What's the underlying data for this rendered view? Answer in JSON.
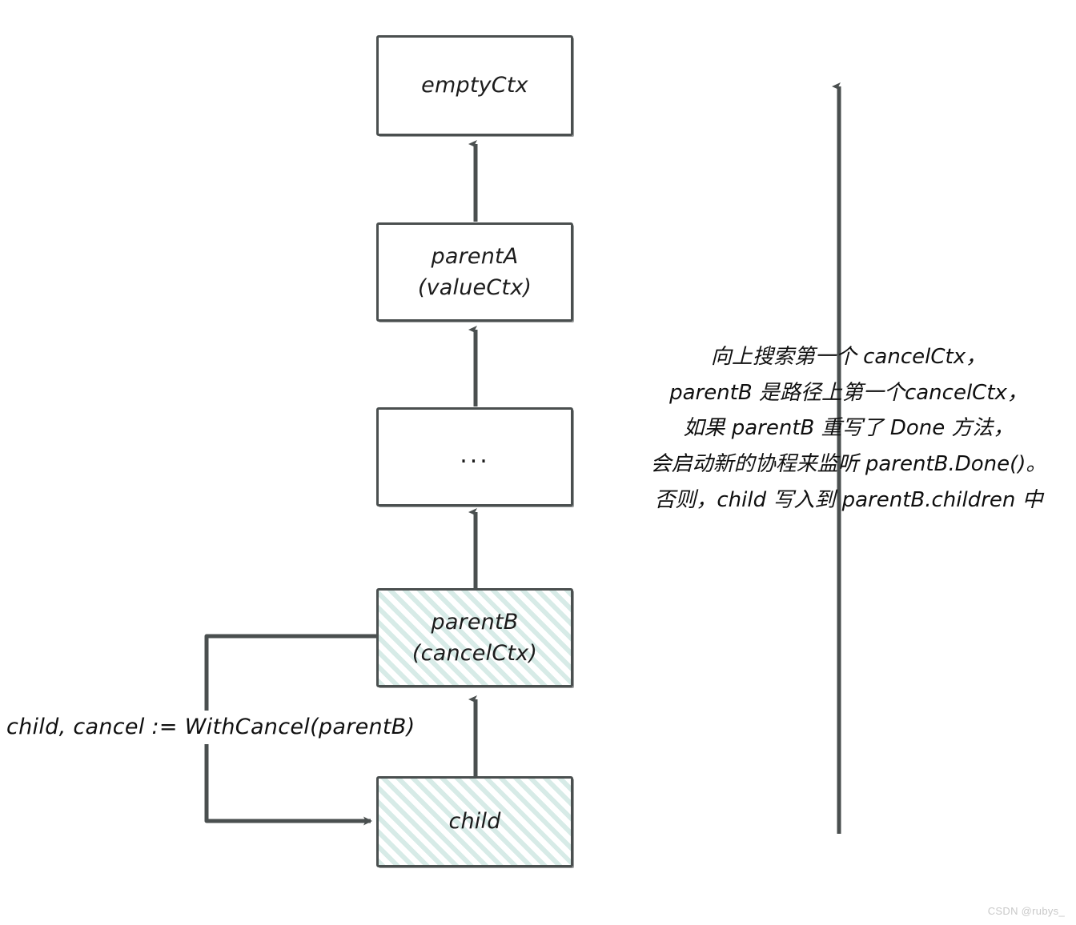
{
  "diagram": {
    "title": "Go context WithCancel parent search",
    "nodes": [
      {
        "id": "emptyCtx",
        "line1": "emptyCtx",
        "line2": "",
        "hatched": false
      },
      {
        "id": "parentA",
        "line1": "parentA",
        "line2": "(valueCtx)",
        "hatched": false
      },
      {
        "id": "ellipsis",
        "line1": "...",
        "line2": "",
        "hatched": false
      },
      {
        "id": "parentB",
        "line1": "parentB",
        "line2": "(cancelCtx)",
        "hatched": true
      },
      {
        "id": "child",
        "line1": "child",
        "line2": "",
        "hatched": true
      }
    ],
    "left_note": "child, cancel := WithCancel(parentB)",
    "right_note_lines": [
      "向上搜索第一个 cancelCtx，",
      "parentB 是路径上第一个cancelCtx，",
      "如果 parentB 重写了 Done 方法，",
      "会启动新的协程来监听 parentB.Done()。",
      "否则，child 写入到 parentB.children 中"
    ],
    "colors": {
      "stroke": "#4a4f4f",
      "hatch": "#d7ebe7",
      "text": "#101010",
      "background": "#ffffff"
    }
  },
  "watermark": "CSDN @rubys_"
}
